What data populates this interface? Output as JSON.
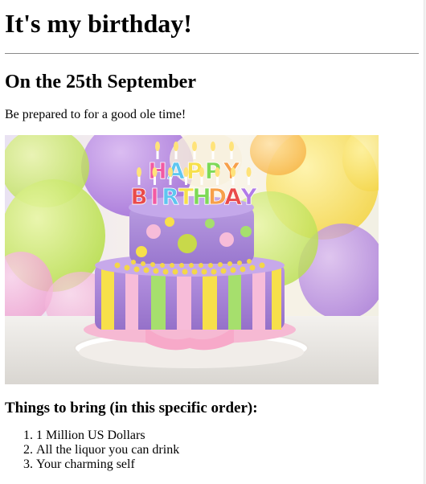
{
  "page": {
    "title": "It's my birthday!",
    "date_heading": "On the 25th September",
    "intro": "Be prepared to for a good ole time!",
    "image": {
      "candle_letters": [
        "H",
        "A",
        "P",
        "P",
        "Y",
        "B",
        "I",
        "R",
        "T",
        "H",
        "D",
        "A",
        "Y"
      ],
      "candle_colors": [
        "#f25aa3",
        "#5fc6f0",
        "#f7e04a",
        "#7ed957",
        "#f7a04a",
        "#e94b4b",
        "#f25aa3",
        "#5fc6f0",
        "#f7e04a",
        "#7ed957",
        "#f7a04a",
        "#e94b4b",
        "#b17be8"
      ]
    },
    "list_heading": "Things to bring (in this specific order):",
    "items": [
      "1 Million US Dollars",
      "All the liquor you can drink",
      "Your charming self"
    ]
  }
}
